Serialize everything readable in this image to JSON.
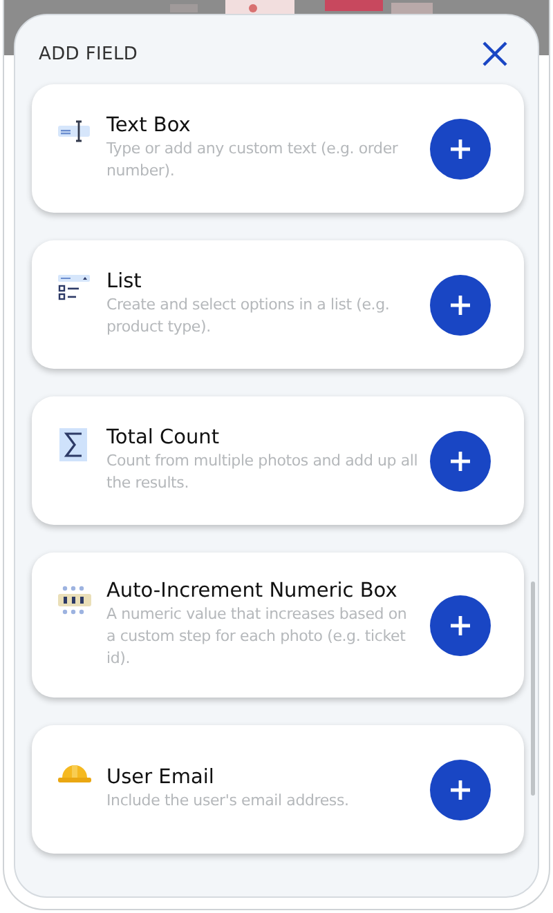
{
  "header": {
    "title": "ADD FIELD"
  },
  "fields": [
    {
      "kind": "text_box",
      "title": "Text Box",
      "description": "Type or add any custom text (e.g. order number)."
    },
    {
      "kind": "list",
      "title": "List",
      "description": "Create and select options in a list (e.g. product type)."
    },
    {
      "kind": "total_count",
      "title": "Total Count",
      "description": "Count from multiple photos and add up all the results."
    },
    {
      "kind": "auto_increment",
      "title": "Auto-Increment Numeric Box",
      "description": "A numeric value that increases based on a custom step for each photo (e.g. ticket id)."
    },
    {
      "kind": "user_email",
      "title": "User Email",
      "description": "Include the user's email address."
    }
  ]
}
